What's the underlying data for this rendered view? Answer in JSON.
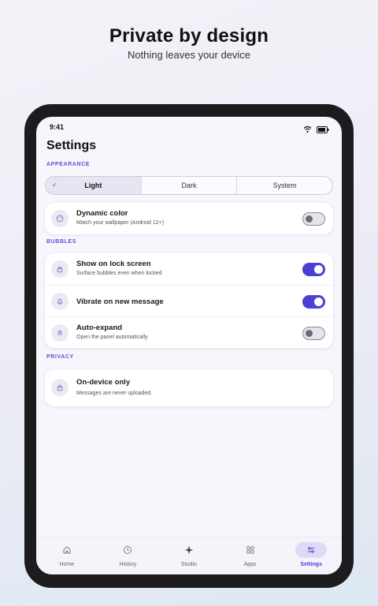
{
  "promo": {
    "headline": "Private by design",
    "subhead": "Nothing leaves your device"
  },
  "status": {
    "time": "9:41",
    "wifi_icon": "wifi-icon",
    "battery_icon": "battery-icon"
  },
  "page": {
    "title": "Settings"
  },
  "appearance": {
    "label": "APPEARANCE",
    "theme_options": [
      {
        "label": "Light",
        "selected": true
      },
      {
        "label": "Dark",
        "selected": false
      },
      {
        "label": "System",
        "selected": false
      }
    ],
    "dynamic_color": {
      "title": "Dynamic color",
      "subtitle": "Match your wallpaper (Android 12+)",
      "enabled": false,
      "icon": "palette-icon"
    }
  },
  "bubbles": {
    "label": "BUBBLES",
    "items": [
      {
        "title": "Show on lock screen",
        "subtitle": "Surface bubbles even when locked",
        "enabled": true,
        "icon": "lock-icon"
      },
      {
        "title": "Vibrate on new message",
        "subtitle": "",
        "enabled": true,
        "icon": "bell-icon"
      },
      {
        "title": "Auto-expand",
        "subtitle": "Open the panel automatically",
        "enabled": false,
        "icon": "expand-icon"
      }
    ]
  },
  "privacy": {
    "label": "PRIVACY",
    "item": {
      "title": "On-device only",
      "subtitle": "Messages are never uploaded.",
      "icon": "lock-icon"
    }
  },
  "nav": {
    "items": [
      {
        "label": "Home",
        "icon": "home-icon",
        "active": false
      },
      {
        "label": "History",
        "icon": "clock-icon",
        "active": false
      },
      {
        "label": "Studio",
        "icon": "sparkle-icon",
        "active": false
      },
      {
        "label": "Apps",
        "icon": "grid-icon",
        "active": false
      },
      {
        "label": "Settings",
        "icon": "sliders-icon",
        "active": true
      }
    ]
  },
  "colors": {
    "accent": "#4b3fd6",
    "section_label": "#5b4fd6",
    "screen_bg": "#f8f6fc"
  }
}
